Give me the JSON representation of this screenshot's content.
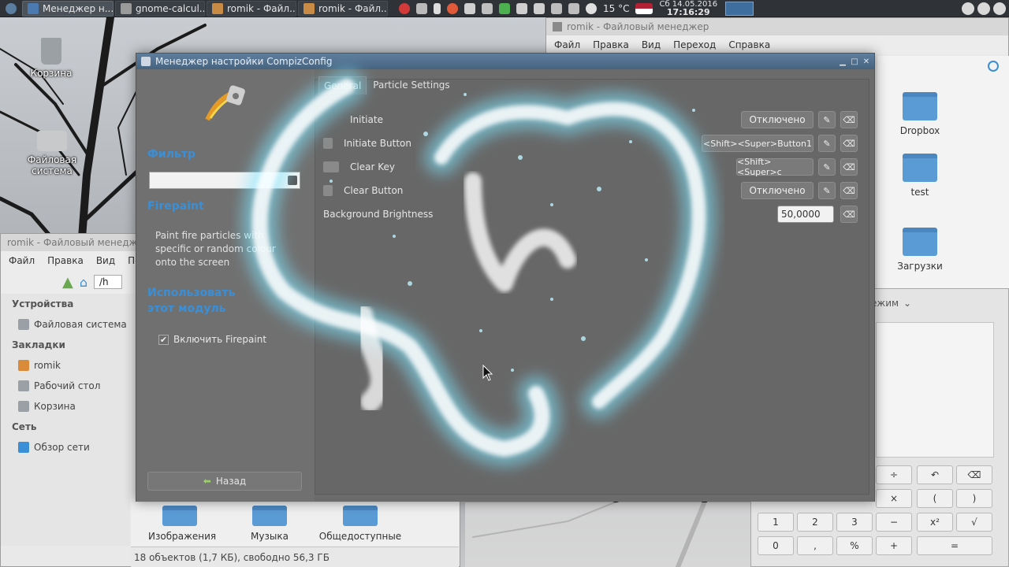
{
  "panel": {
    "tasks": [
      {
        "label": "Менеджер н...",
        "active": true
      },
      {
        "label": "gnome-calcul...",
        "active": false
      },
      {
        "label": "romik - Файл...",
        "active": false
      },
      {
        "label": "romik - Файл...",
        "active": false
      }
    ],
    "weather": "15 °C",
    "date": "Сб 14.05.2016",
    "time": "17:16:29"
  },
  "desktop_icons": {
    "trash": "Корзина",
    "filesystem": "Файловая система"
  },
  "fm_right": {
    "title": "romik - Файловый менеджер",
    "menu": [
      "Файл",
      "Правка",
      "Вид",
      "Переход",
      "Справка"
    ],
    "folders": [
      "Dropbox",
      "test",
      "Загрузки"
    ]
  },
  "fm_left": {
    "title": "romik - Файловый менеджер",
    "menu": [
      "Файл",
      "Правка",
      "Вид",
      "Пе"
    ],
    "path": "/h",
    "sections": {
      "devices": "Устройства",
      "filesystem": "Файловая система",
      "bookmarks": "Закладки",
      "home": "romik",
      "desktop": "Рабочий стол",
      "trash": "Корзина",
      "network": "Сеть",
      "browse": "Обзор сети"
    },
    "bottom_folders": [
      "Изображения",
      "Музыка",
      "Общедоступные"
    ],
    "status": "18 объектов (1,7 КБ), свободно 56,3 ГБ"
  },
  "calculator": {
    "mode": "ежим",
    "keys": [
      "÷",
      "↶",
      "⌫",
      "×",
      "(",
      ")",
      "1",
      "2",
      "3",
      "−",
      "x²",
      "√",
      "0",
      ",",
      "%",
      "+",
      "="
    ]
  },
  "ccsm": {
    "title": "Менеджер настройки CompizConfig",
    "filter_label": "Фильтр",
    "plugin_name": "Firepaint",
    "description": "Paint fire particles with specific or random colour onto the screen",
    "use_module": "Использовать этот модуль",
    "enable_label": "Включить Firepaint",
    "enabled": true,
    "back_label": "Назад",
    "tabs": [
      "General",
      "Particle Settings"
    ],
    "settings": [
      {
        "label": "Initiate",
        "value": "Отключено"
      },
      {
        "label": "Initiate Button",
        "value": "<Shift><Super>Button1"
      },
      {
        "label": "Clear Key",
        "value": "<Shift><Super>c"
      },
      {
        "label": "Clear Button",
        "value": "Отключено"
      },
      {
        "label": "Background Brightness",
        "value": "50,0000"
      }
    ]
  }
}
